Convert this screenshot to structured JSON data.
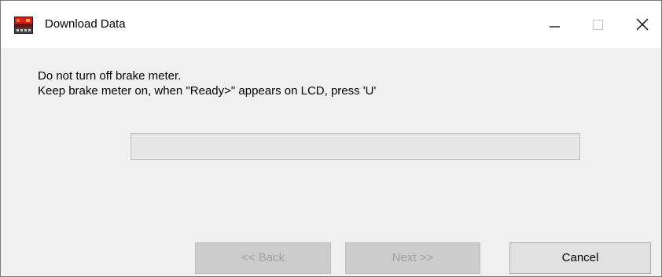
{
  "window": {
    "title": "Download Data",
    "icon": "brake-meter-app-icon",
    "controls": {
      "minimize_icon": "minimize-icon",
      "maximize_icon": "maximize-icon",
      "close_icon": "close-icon"
    }
  },
  "message": {
    "line1": "Do not turn off brake meter.",
    "line2": "Keep brake meter on, when \"Ready>\" appears on LCD, press 'U'"
  },
  "progress": {
    "value": 0
  },
  "buttons": {
    "back_label": "<< Back",
    "back_enabled": false,
    "next_label": "Next >>",
    "next_enabled": false,
    "cancel_label": "Cancel",
    "cancel_enabled": true
  },
  "colors": {
    "window_background": "#f0f0f0",
    "titlebar_background": "#ffffff",
    "progress_track": "#e6e6e6",
    "progress_fill": "#06b025",
    "disabled_button": "#cccccc",
    "button": "#e1e1e1"
  }
}
